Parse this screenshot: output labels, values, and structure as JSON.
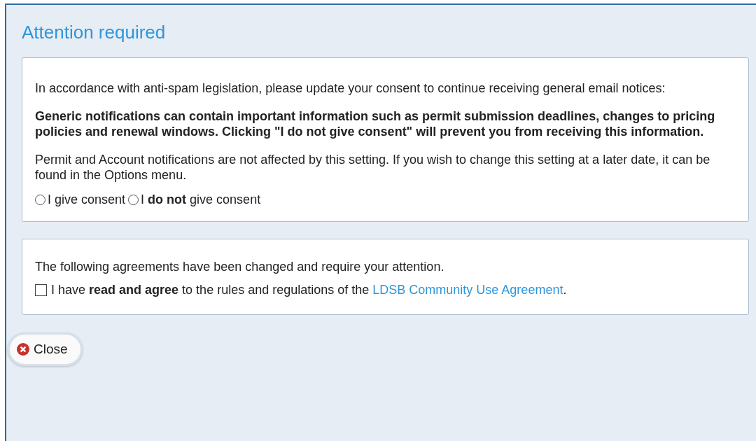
{
  "dialog": {
    "title": "Attention required"
  },
  "consent_panel": {
    "intro": "In accordance with anti-spam legislation, please update your consent to continue receiving general email notices:",
    "warning": "Generic notifications can contain important information such as permit submission deadlines, changes to pricing policies and renewal windows. Clicking \"I do not give consent\" will prevent you from receiving this information.",
    "note": "Permit and Account notifications are not affected by this setting. If you wish to change this setting at a later date, it can be found in the Options menu.",
    "options": [
      {
        "label": "I give consent",
        "selected": false
      },
      {
        "label": "I **do not** give consent",
        "selected": false
      }
    ]
  },
  "agreements_panel": {
    "intro": "The following agreements have been changed and require your attention.",
    "agreement": {
      "checked": false,
      "text_before": "I have **read and agree** to the rules and regulations of the ",
      "link": "LDSB Community Use Agreement",
      "text_after": "."
    }
  },
  "buttons": [
    {
      "kind": "close",
      "label": "Close"
    }
  ]
}
